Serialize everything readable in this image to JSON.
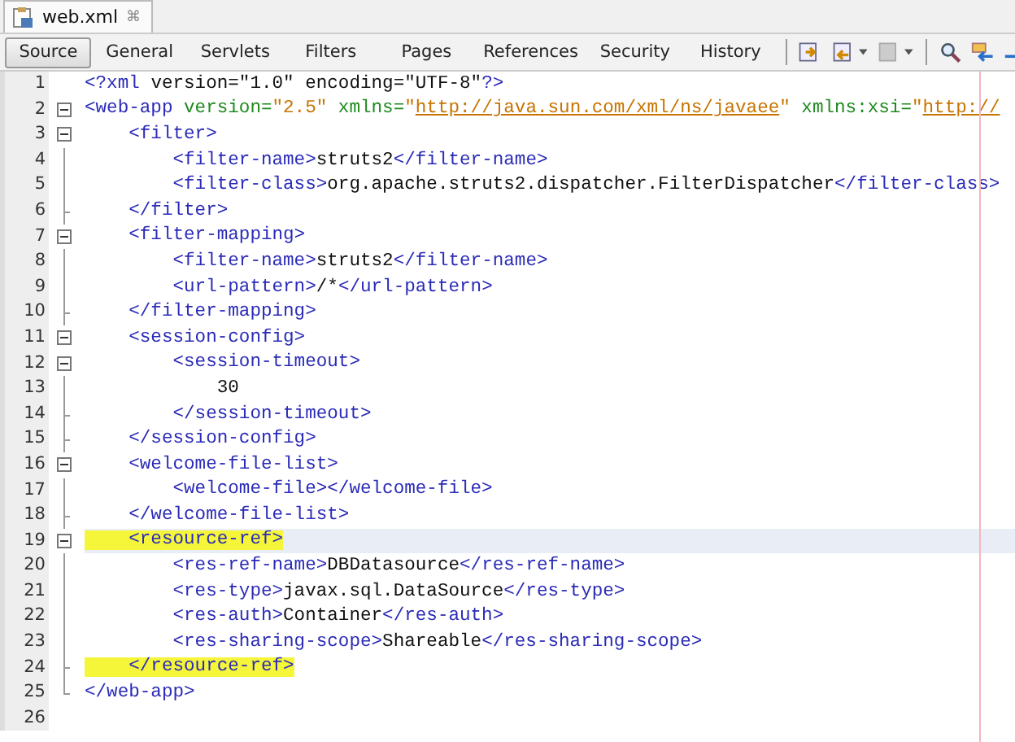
{
  "file_tab": {
    "title": "web.xml",
    "close": "⌘"
  },
  "view_tabs": [
    {
      "label": "Source",
      "selected": true
    },
    {
      "label": "General",
      "selected": false
    },
    {
      "label": "Servlets",
      "selected": false
    },
    {
      "label": "Filters",
      "selected": false
    },
    {
      "label": "Pages",
      "selected": false
    },
    {
      "label": "References",
      "selected": false
    },
    {
      "label": "Security",
      "selected": false
    },
    {
      "label": "History",
      "selected": false
    }
  ],
  "editor": {
    "lines": [
      {
        "number": "1",
        "kind": "plain",
        "current": false,
        "highlighted": false,
        "tokens": [
          {
            "kind": "tag",
            "text": "<?xml "
          },
          {
            "kind": "text",
            "text": "version=\"1.0\" encoding=\"UTF-8\""
          },
          {
            "kind": "tag",
            "text": "?>"
          }
        ]
      },
      {
        "number": "2",
        "kind": "open",
        "current": false,
        "highlighted": false,
        "tokens": [
          {
            "kind": "tag",
            "text": "<web-app "
          },
          {
            "kind": "attr",
            "text": "version="
          },
          {
            "kind": "value",
            "text": "\"2.5\""
          },
          {
            "kind": "attr",
            "text": " xmlns="
          },
          {
            "kind": "value",
            "text": "\""
          },
          {
            "kind": "url",
            "text": "http://java.sun.com/xml/ns/javaee"
          },
          {
            "kind": "value",
            "text": "\""
          },
          {
            "kind": "attr",
            "text": " xmlns:xsi="
          },
          {
            "kind": "value",
            "text": "\""
          },
          {
            "kind": "url",
            "text": "http://"
          }
        ]
      },
      {
        "number": "3",
        "kind": "open",
        "current": false,
        "highlighted": false,
        "tokens": [
          {
            "kind": "tag",
            "text": "    <filter>"
          }
        ]
      },
      {
        "number": "4",
        "kind": "body",
        "current": false,
        "highlighted": false,
        "tokens": [
          {
            "kind": "tag",
            "text": "        <filter-name>"
          },
          {
            "kind": "text",
            "text": "struts2"
          },
          {
            "kind": "tag",
            "text": "</filter-name>"
          }
        ]
      },
      {
        "number": "5",
        "kind": "body",
        "current": false,
        "highlighted": false,
        "tokens": [
          {
            "kind": "tag",
            "text": "        <filter-class>"
          },
          {
            "kind": "text",
            "text": "org.apache.struts2.dispatcher.FilterDispatcher"
          },
          {
            "kind": "tag",
            "text": "</filter-class>"
          }
        ]
      },
      {
        "number": "6",
        "kind": "close",
        "current": false,
        "highlighted": false,
        "tokens": [
          {
            "kind": "tag",
            "text": "    </filter>"
          }
        ]
      },
      {
        "number": "7",
        "kind": "open",
        "current": false,
        "highlighted": false,
        "tokens": [
          {
            "kind": "tag",
            "text": "    <filter-mapping>"
          }
        ]
      },
      {
        "number": "8",
        "kind": "body",
        "current": false,
        "highlighted": false,
        "tokens": [
          {
            "kind": "tag",
            "text": "        <filter-name>"
          },
          {
            "kind": "text",
            "text": "struts2"
          },
          {
            "kind": "tag",
            "text": "</filter-name>"
          }
        ]
      },
      {
        "number": "9",
        "kind": "body",
        "current": false,
        "highlighted": false,
        "tokens": [
          {
            "kind": "tag",
            "text": "        <url-pattern>"
          },
          {
            "kind": "text",
            "text": "/*"
          },
          {
            "kind": "tag",
            "text": "</url-pattern>"
          }
        ]
      },
      {
        "number": "10",
        "kind": "close",
        "current": false,
        "highlighted": false,
        "tokens": [
          {
            "kind": "tag",
            "text": "    </filter-mapping>"
          }
        ]
      },
      {
        "number": "11",
        "kind": "open",
        "current": false,
        "highlighted": false,
        "tokens": [
          {
            "kind": "tag",
            "text": "    <session-config>"
          }
        ]
      },
      {
        "number": "12",
        "kind": "open",
        "current": false,
        "highlighted": false,
        "tokens": [
          {
            "kind": "tag",
            "text": "        <session-timeout>"
          }
        ]
      },
      {
        "number": "13",
        "kind": "body",
        "current": false,
        "highlighted": false,
        "tokens": [
          {
            "kind": "text",
            "text": "            30"
          }
        ]
      },
      {
        "number": "14",
        "kind": "close",
        "current": false,
        "highlighted": false,
        "tokens": [
          {
            "kind": "tag",
            "text": "        </session-timeout>"
          }
        ]
      },
      {
        "number": "15",
        "kind": "close",
        "current": false,
        "highlighted": false,
        "tokens": [
          {
            "kind": "tag",
            "text": "    </session-config>"
          }
        ]
      },
      {
        "number": "16",
        "kind": "open",
        "current": false,
        "highlighted": false,
        "tokens": [
          {
            "kind": "tag",
            "text": "    <welcome-file-list>"
          }
        ]
      },
      {
        "number": "17",
        "kind": "body",
        "current": false,
        "highlighted": false,
        "tokens": [
          {
            "kind": "tag",
            "text": "        <welcome-file></welcome-file>"
          }
        ]
      },
      {
        "number": "18",
        "kind": "close",
        "current": false,
        "highlighted": false,
        "tokens": [
          {
            "kind": "tag",
            "text": "    </welcome-file-list>"
          }
        ]
      },
      {
        "number": "19",
        "kind": "open",
        "current": true,
        "highlighted": true,
        "tokens": [
          {
            "kind": "tag",
            "text": "    <resource-ref>"
          }
        ]
      },
      {
        "number": "20",
        "kind": "body",
        "current": false,
        "highlighted": false,
        "tokens": [
          {
            "kind": "tag",
            "text": "        <res-ref-name>"
          },
          {
            "kind": "text",
            "text": "DBDatasource"
          },
          {
            "kind": "tag",
            "text": "</res-ref-name>"
          }
        ]
      },
      {
        "number": "21",
        "kind": "body",
        "current": false,
        "highlighted": false,
        "tokens": [
          {
            "kind": "tag",
            "text": "        <res-type>"
          },
          {
            "kind": "text",
            "text": "javax.sql.DataSource"
          },
          {
            "kind": "tag",
            "text": "</res-type>"
          }
        ]
      },
      {
        "number": "22",
        "kind": "body",
        "current": false,
        "highlighted": false,
        "tokens": [
          {
            "kind": "tag",
            "text": "        <res-auth>"
          },
          {
            "kind": "text",
            "text": "Container"
          },
          {
            "kind": "tag",
            "text": "</res-auth>"
          }
        ]
      },
      {
        "number": "23",
        "kind": "body",
        "current": false,
        "highlighted": false,
        "tokens": [
          {
            "kind": "tag",
            "text": "        <res-sharing-scope>"
          },
          {
            "kind": "text",
            "text": "Shareable"
          },
          {
            "kind": "tag",
            "text": "</res-sharing-scope>"
          }
        ]
      },
      {
        "number": "24",
        "kind": "close",
        "current": false,
        "highlighted": true,
        "tokens": [
          {
            "kind": "tag",
            "text": "    </resource-ref>"
          }
        ]
      },
      {
        "number": "25",
        "kind": "end",
        "current": false,
        "highlighted": false,
        "tokens": [
          {
            "kind": "tag",
            "text": "</web-app>"
          }
        ]
      },
      {
        "number": "26",
        "kind": "plain",
        "current": false
      }
    ]
  }
}
